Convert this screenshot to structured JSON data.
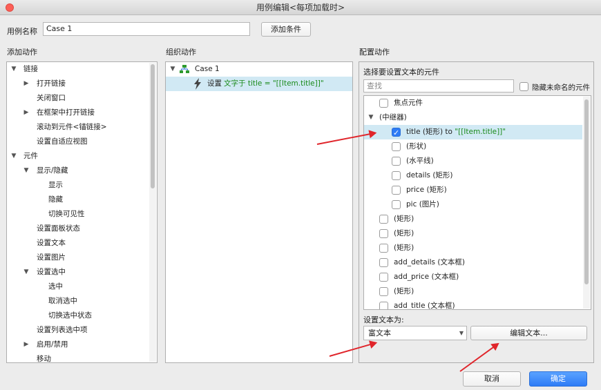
{
  "window": {
    "title": "用例编辑<每项加载时>"
  },
  "header": {
    "case_name_label": "用例名称",
    "case_name_value": "Case 1",
    "add_condition": "添加条件"
  },
  "left": {
    "title": "添加动作",
    "items": [
      {
        "label": "链接",
        "level": 0,
        "expander": "open"
      },
      {
        "label": "打开链接",
        "level": 1,
        "expander": "closed"
      },
      {
        "label": "关闭窗口",
        "level": 1,
        "expander": ""
      },
      {
        "label": "在框架中打开链接",
        "level": 1,
        "expander": "closed"
      },
      {
        "label": "滚动到元件<锚链接>",
        "level": 1,
        "expander": ""
      },
      {
        "label": "设置自适应视图",
        "level": 1,
        "expander": ""
      },
      {
        "label": "元件",
        "level": 0,
        "expander": "open"
      },
      {
        "label": "显示/隐藏",
        "level": 1,
        "expander": "open"
      },
      {
        "label": "显示",
        "level": 2,
        "expander": ""
      },
      {
        "label": "隐藏",
        "level": 2,
        "expander": ""
      },
      {
        "label": "切换可见性",
        "level": 2,
        "expander": ""
      },
      {
        "label": "设置面板状态",
        "level": 1,
        "expander": ""
      },
      {
        "label": "设置文本",
        "level": 1,
        "expander": ""
      },
      {
        "label": "设置图片",
        "level": 1,
        "expander": ""
      },
      {
        "label": "设置选中",
        "level": 1,
        "expander": "open"
      },
      {
        "label": "选中",
        "level": 2,
        "expander": ""
      },
      {
        "label": "取消选中",
        "level": 2,
        "expander": ""
      },
      {
        "label": "切换选中状态",
        "level": 2,
        "expander": ""
      },
      {
        "label": "设置列表选中项",
        "level": 1,
        "expander": ""
      },
      {
        "label": "启用/禁用",
        "level": 1,
        "expander": "closed"
      },
      {
        "label": "移动",
        "level": 1,
        "expander": ""
      }
    ]
  },
  "middle": {
    "title": "组织动作",
    "case_label": "Case 1",
    "action_prefix": "设置",
    "action_detail": "文字于 title = \"[[Item.title]]\""
  },
  "right": {
    "title": "配置动作",
    "subtitle": "选择要设置文本的元件",
    "search_placeholder": "查找",
    "hide_unnamed": "隐藏未命名的元件",
    "items": [
      {
        "label": "焦点元件",
        "level": 1,
        "checked": false,
        "expander": false,
        "suffix": ""
      },
      {
        "label": "(中继器)",
        "level": 0,
        "checked": null,
        "expander": true,
        "suffix": ""
      },
      {
        "label": "title (矩形) to ",
        "level": 2,
        "checked": true,
        "expander": false,
        "suffix": "\"[[Item.title]]\"",
        "selected": true
      },
      {
        "label": "(形状)",
        "level": 2,
        "checked": false,
        "expander": false,
        "suffix": ""
      },
      {
        "label": "(水平线)",
        "level": 2,
        "checked": false,
        "expander": false,
        "suffix": ""
      },
      {
        "label": "details (矩形)",
        "level": 2,
        "checked": false,
        "expander": false,
        "suffix": ""
      },
      {
        "label": "price (矩形)",
        "level": 2,
        "checked": false,
        "expander": false,
        "suffix": ""
      },
      {
        "label": "pic (图片)",
        "level": 2,
        "checked": false,
        "expander": false,
        "suffix": ""
      },
      {
        "label": "(矩形)",
        "level": 1,
        "checked": false,
        "expander": false,
        "suffix": ""
      },
      {
        "label": "(矩形)",
        "level": 1,
        "checked": false,
        "expander": false,
        "suffix": ""
      },
      {
        "label": "(矩形)",
        "level": 1,
        "checked": false,
        "expander": false,
        "suffix": ""
      },
      {
        "label": "add_details (文本框)",
        "level": 1,
        "checked": false,
        "expander": false,
        "suffix": ""
      },
      {
        "label": "add_price (文本框)",
        "level": 1,
        "checked": false,
        "expander": false,
        "suffix": ""
      },
      {
        "label": "(矩形)",
        "level": 1,
        "checked": false,
        "expander": false,
        "suffix": ""
      },
      {
        "label": "add_title (文本框)",
        "level": 1,
        "checked": false,
        "expander": false,
        "suffix": ""
      }
    ],
    "set_text_label": "设置文本为:",
    "text_type": "富文本",
    "edit_text": "编辑文本..."
  },
  "footer": {
    "cancel": "取消",
    "ok": "确定"
  },
  "colors": {
    "accent": "#2e7cf6",
    "selection": "#d1e9f4",
    "annotation": "#e0252b",
    "code_green": "#1a8a1a"
  }
}
